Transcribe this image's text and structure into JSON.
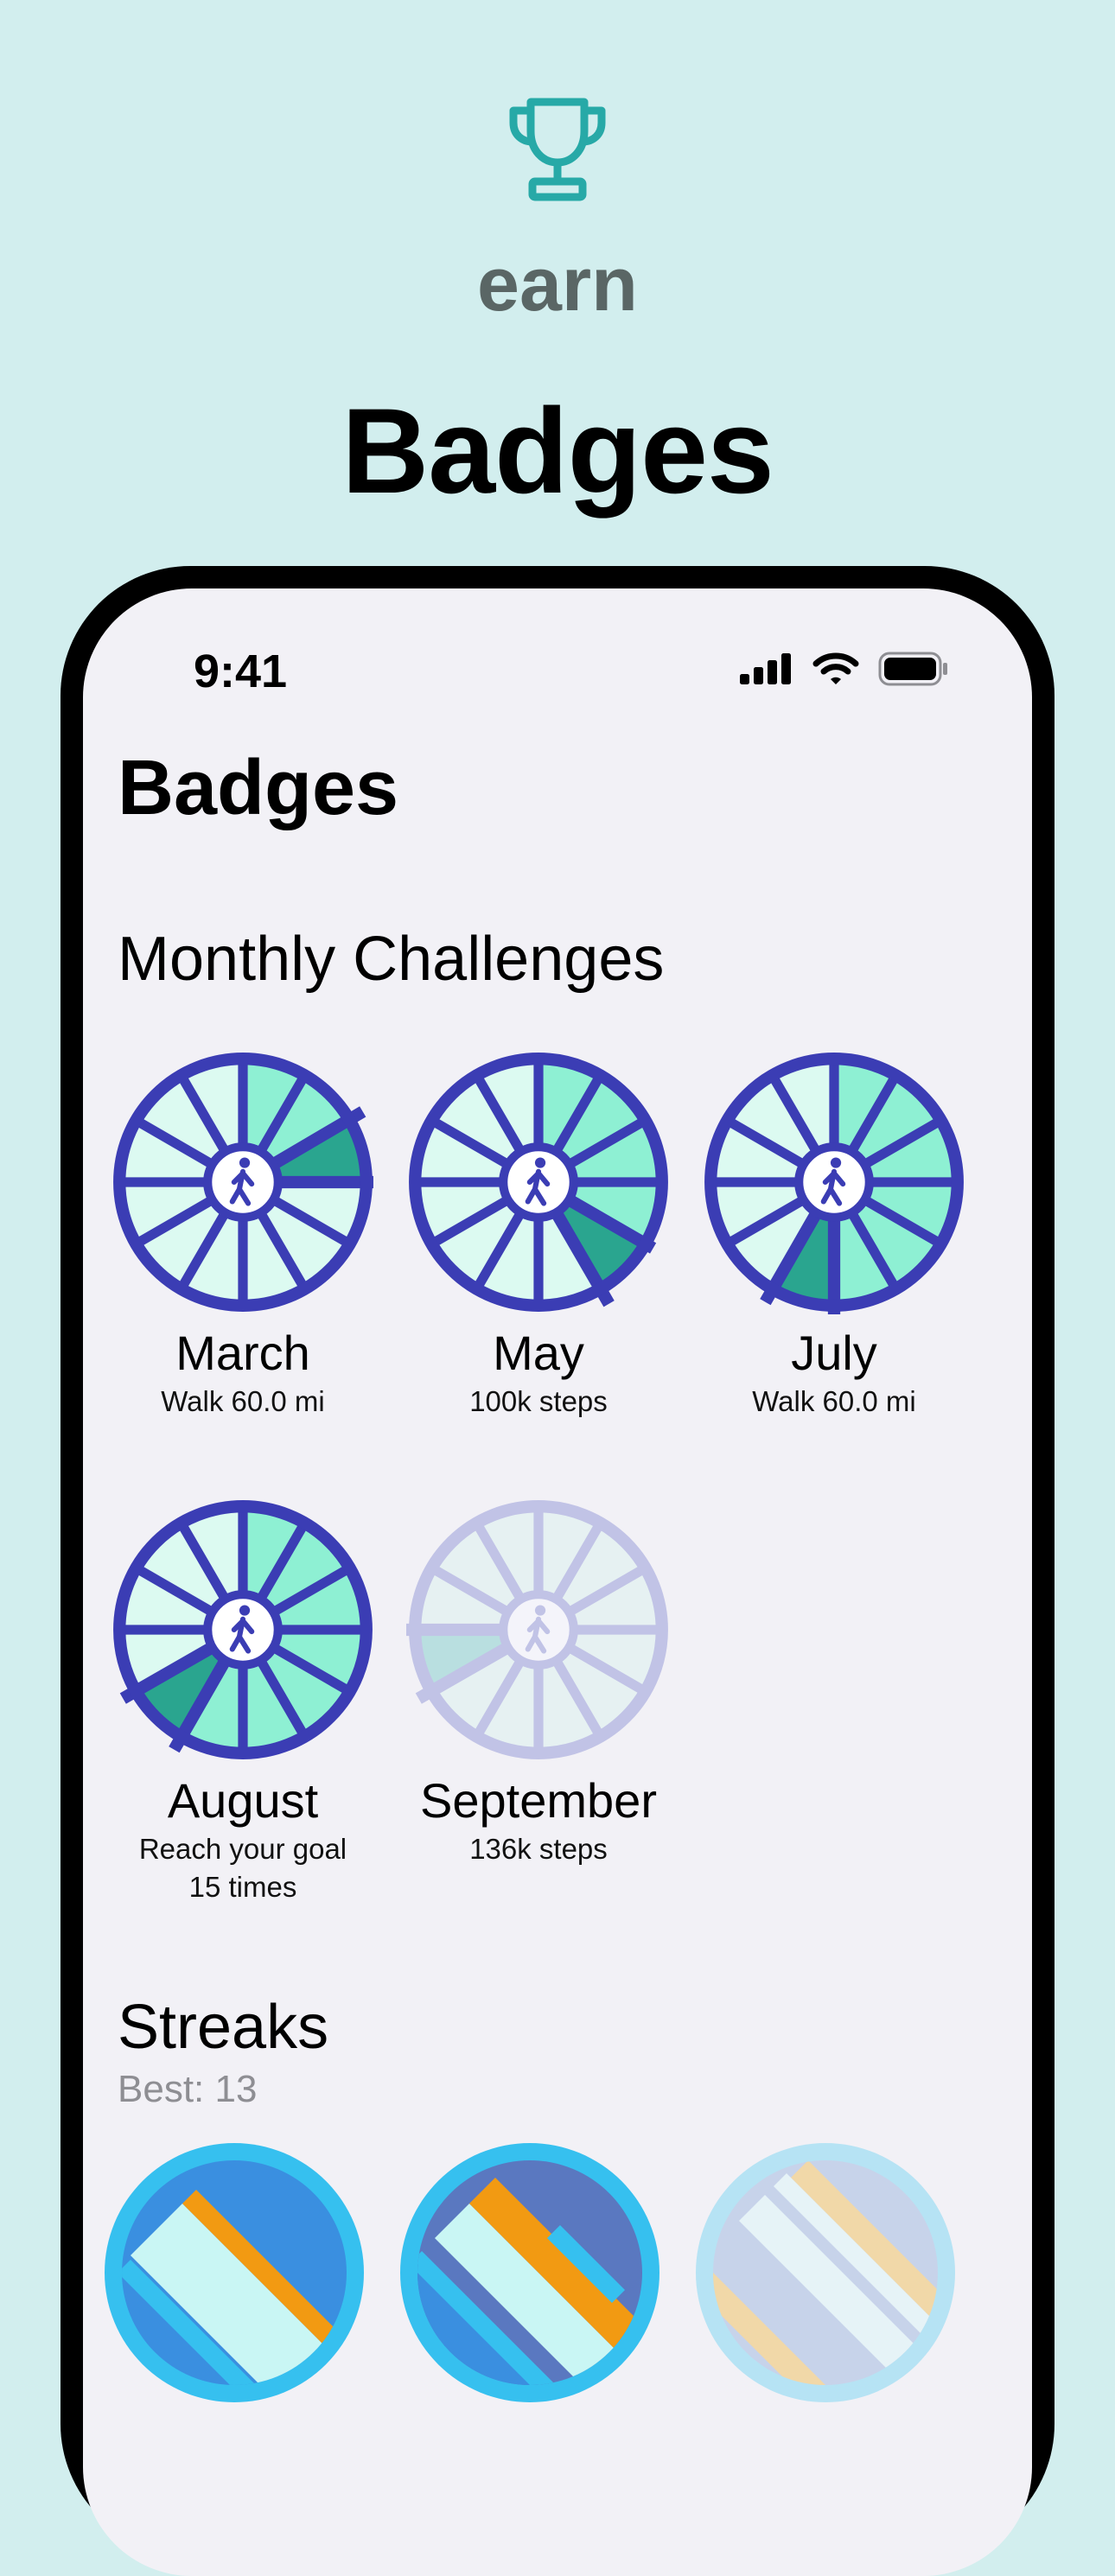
{
  "hero": {
    "icon": "trophy-icon",
    "subtitle": "earn",
    "title": "Badges",
    "accent_color": "#27a9a7"
  },
  "status_bar": {
    "time": "9:41",
    "icons": [
      "cellular-signal-icon",
      "wifi-icon",
      "battery-icon"
    ]
  },
  "screen": {
    "title": "Badges",
    "monthly_section": {
      "title": "Monthly Challenges",
      "badges": [
        {
          "month": "March",
          "goal": "Walk 60.0 mi",
          "icon": "walking-person-icon",
          "locked": false
        },
        {
          "month": "May",
          "goal": "100k steps",
          "icon": "walking-person-icon",
          "locked": false
        },
        {
          "month": "July",
          "goal": "Walk 60.0 mi",
          "icon": "walking-person-icon",
          "locked": false
        },
        {
          "month": "August",
          "goal": "Reach your goal\n15 times",
          "icon": "walking-person-icon",
          "locked": false
        },
        {
          "month": "September",
          "goal": "136k steps",
          "icon": "walking-person-icon",
          "locked": true
        }
      ]
    },
    "streaks_section": {
      "title": "Streaks",
      "best": "Best: 13"
    }
  },
  "colors": {
    "background": "#d2eeee",
    "screen": "#f2f1f6",
    "badge_ring": "#3b3db4",
    "badge_fill_light": "#dcfaf1",
    "badge_fill_mint": "#8ef0d3",
    "badge_fill_teal": "#2aa58f",
    "streak_ring": "#36c0ef",
    "streak_blue": "#3a8fe0",
    "streak_orange": "#f29a12"
  }
}
